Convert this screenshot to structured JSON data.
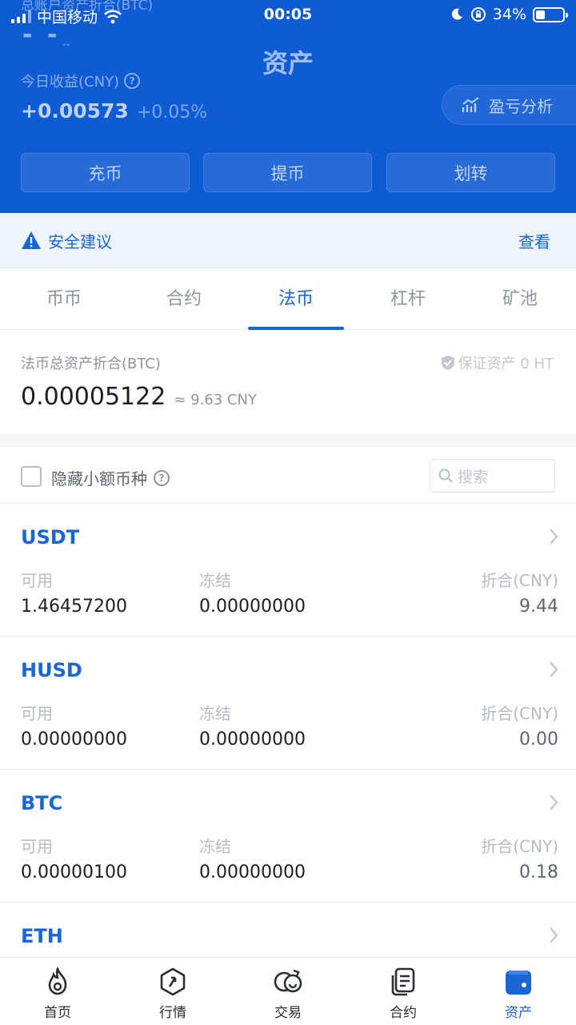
{
  "status_bar": {
    "carrier": "中国移动",
    "time": "00:05",
    "battery": "34%",
    "battery_level": 0.34
  },
  "header": {
    "faded_label": "总账户资产折合(BTC)",
    "total_value": "- -",
    "total_sub": "--",
    "title": "资产",
    "today_label": "今日收益(CNY)",
    "today_profit": "+0.00573",
    "today_pct": "+0.05%",
    "analysis_label": "盈亏分析",
    "buttons": {
      "deposit": "充币",
      "withdraw": "提币",
      "transfer": "划转"
    }
  },
  "security_tip": {
    "label": "安全建议",
    "action": "查看"
  },
  "tabs": [
    {
      "label": "币币"
    },
    {
      "label": "合约"
    },
    {
      "label": "法币"
    },
    {
      "label": "杠杆"
    },
    {
      "label": "矿池"
    }
  ],
  "summary": {
    "label": "法币总资产折合(BTC)",
    "guarantee": "保证资产 0 HT",
    "value": "0.00005122",
    "cny": "≈ 9.63 CNY"
  },
  "filter": {
    "hide_small": "隐藏小额币种",
    "search_placeholder": "搜索"
  },
  "columns": {
    "available": "可用",
    "frozen": "冻结",
    "worth": "折合(CNY)"
  },
  "assets": [
    {
      "name": "USDT",
      "available": "1.46457200",
      "frozen": "0.00000000",
      "worth": "9.44"
    },
    {
      "name": "HUSD",
      "available": "0.00000000",
      "frozen": "0.00000000",
      "worth": "0.00"
    },
    {
      "name": "BTC",
      "available": "0.00000100",
      "frozen": "0.00000000",
      "worth": "0.18"
    },
    {
      "name": "ETH"
    }
  ],
  "bottom_nav": [
    {
      "label": "首页"
    },
    {
      "label": "行情"
    },
    {
      "label": "交易"
    },
    {
      "label": "合约"
    },
    {
      "label": "资产"
    }
  ],
  "colors": {
    "brand_blue": "#0f5bd4",
    "accent_blue": "#1a66d6"
  }
}
